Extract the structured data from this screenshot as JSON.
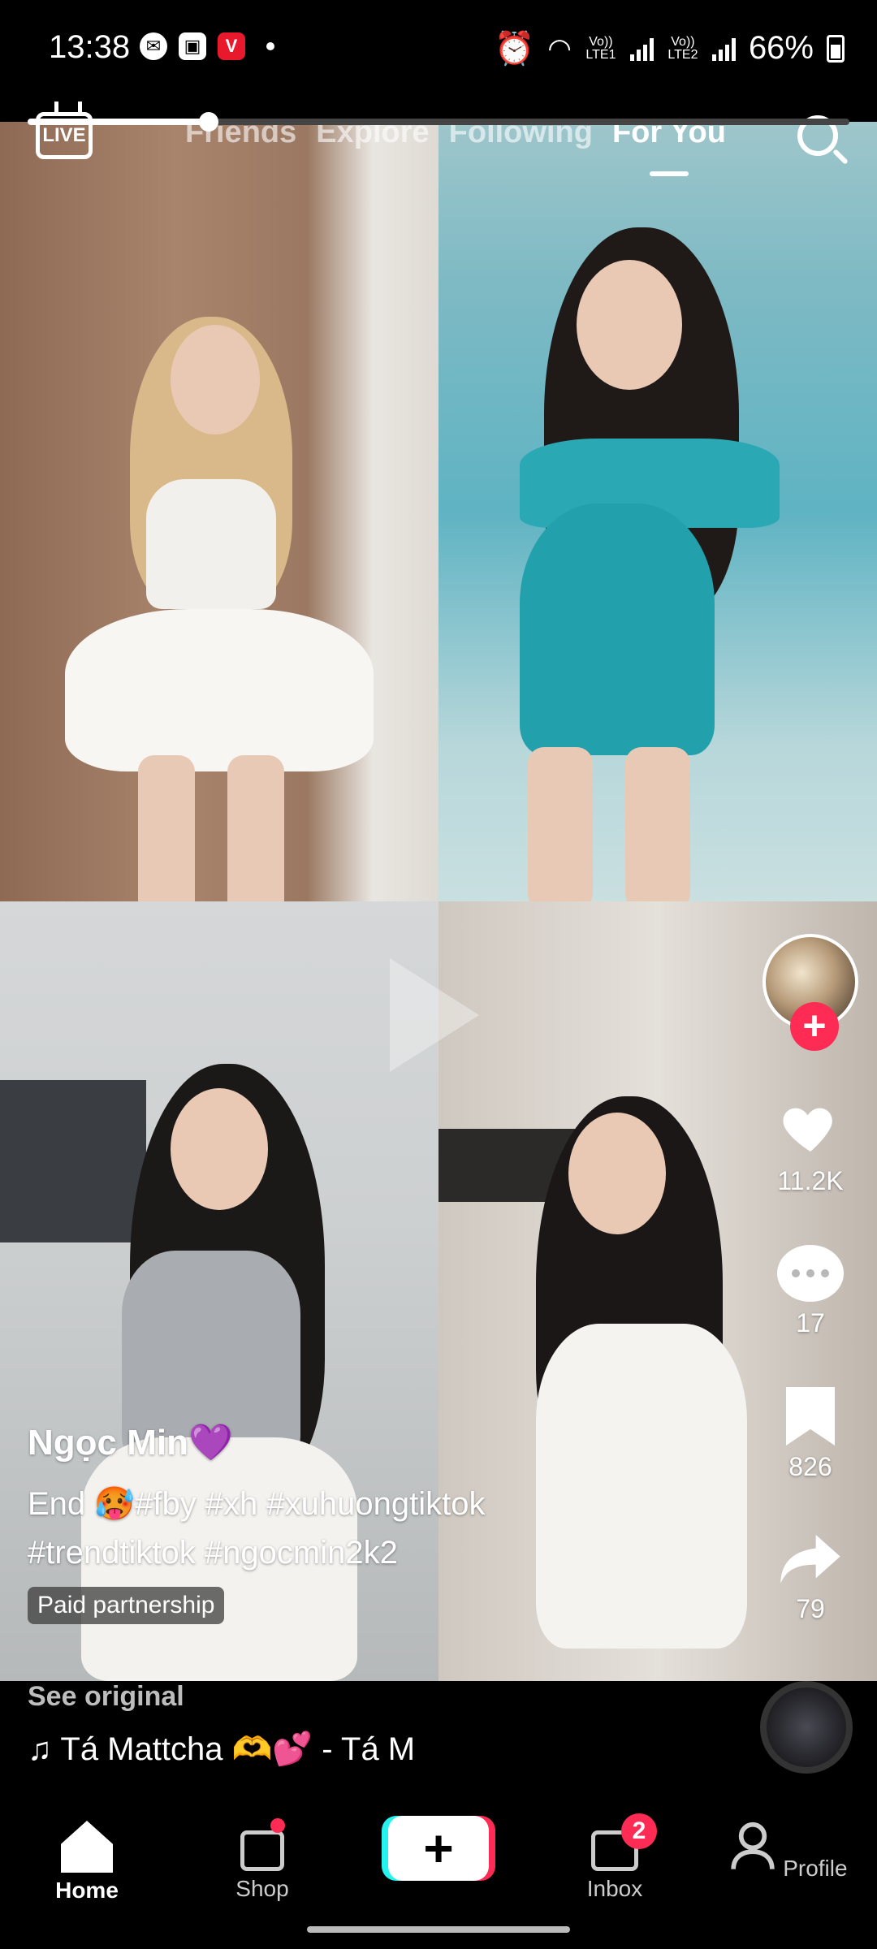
{
  "status_bar": {
    "time": "13:38",
    "battery": "66%",
    "sim1": "Vo)) LTE1",
    "sim2": "Vo)) LTE2",
    "notification_icons": [
      "messenger-icon",
      "gallery-icon",
      "v-app-icon"
    ]
  },
  "top_nav": {
    "tabs": [
      {
        "label": "Friends",
        "active": false
      },
      {
        "label": "Explore",
        "active": false
      },
      {
        "label": "Following",
        "active": false
      },
      {
        "label": "For You",
        "active": true
      }
    ],
    "live_label": "LIVE"
  },
  "actions": {
    "likes": "11.2K",
    "comments": "17",
    "saves": "826",
    "shares": "79",
    "follow_symbol": "+"
  },
  "caption": {
    "username": "Ngọc Min💜",
    "description_line1": "End 🥵#fby #xh #xuhuongtiktok",
    "description_line2": "#trendtiktok #ngocmin2k2",
    "paid_label": "Paid partnership"
  },
  "sound": {
    "see_original": "See original",
    "title": "♫ Tá Mattcha 🫶💕 - Tá M"
  },
  "progress": {
    "fraction": 0.22
  },
  "bottom_nav": {
    "items": [
      {
        "label": "Home",
        "active": true
      },
      {
        "label": "Shop",
        "active": false
      },
      {
        "label": "",
        "active": false
      },
      {
        "label": "Inbox",
        "active": false,
        "badge": "2"
      },
      {
        "label": "Profile",
        "active": false
      }
    ],
    "create_symbol": "+"
  },
  "colors": {
    "accent": "#fe2c55",
    "cyan": "#25f4ee"
  }
}
